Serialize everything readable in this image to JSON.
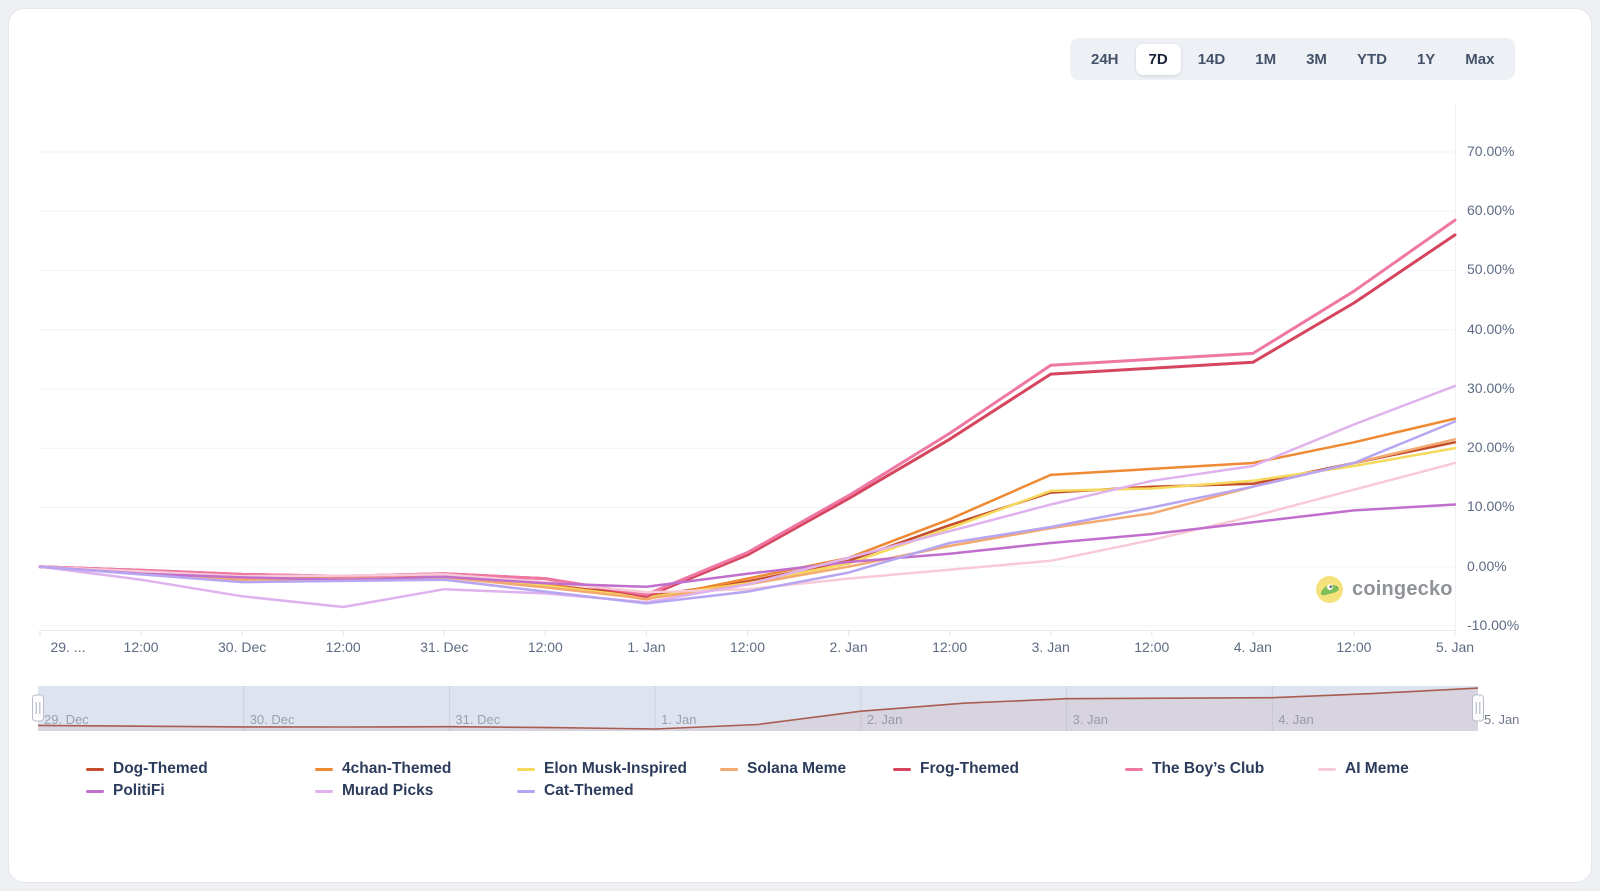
{
  "range_selector": {
    "options": [
      "24H",
      "7D",
      "14D",
      "1M",
      "3M",
      "YTD",
      "1Y",
      "Max"
    ],
    "active": "7D"
  },
  "watermark": {
    "brand": "coingecko"
  },
  "chart_data": {
    "type": "line",
    "categories": [
      "29. ...",
      "12:00",
      "30. Dec",
      "12:00",
      "31. Dec",
      "12:00",
      "1. Jan",
      "12:00",
      "2. Jan",
      "12:00",
      "3. Jan",
      "12:00",
      "4. Jan",
      "12:00",
      "5. Jan"
    ],
    "yticks": [
      {
        "label": "70.00%",
        "value": 70
      },
      {
        "label": "60.00%",
        "value": 60
      },
      {
        "label": "50.00%",
        "value": 50
      },
      {
        "label": "40.00%",
        "value": 40
      },
      {
        "label": "30.00%",
        "value": 30
      },
      {
        "label": "20.00%",
        "value": 20
      },
      {
        "label": "10.00%",
        "value": 10
      },
      {
        "label": "0.00%",
        "value": 0
      },
      {
        "label": "-10.00%",
        "value": -10
      }
    ],
    "ylim": [
      -10,
      70
    ],
    "grid": true,
    "legend_position": "bottom",
    "series": [
      {
        "name": "Dog-Themed",
        "color": "#C44D2C",
        "width": 2.5,
        "values": [
          0,
          -1,
          -2,
          -2,
          -1.5,
          -3,
          -5,
          -2.5,
          1,
          7,
          12.5,
          13.5,
          14,
          17.5,
          21
        ]
      },
      {
        "name": "4chan-Themed",
        "color": "#EE8A33",
        "width": 2.5,
        "values": [
          0,
          -1,
          -2,
          -1.8,
          -1.5,
          -3,
          -5.5,
          -2,
          1.5,
          8,
          15.5,
          16.5,
          17.5,
          21,
          25
        ]
      },
      {
        "name": "Elon Musk-Inspired",
        "color": "#F6D95C",
        "width": 2.5,
        "values": [
          0,
          -1.2,
          -2.2,
          -2,
          -1.8,
          -3.2,
          -5.2,
          -2.8,
          0.5,
          6.5,
          12.8,
          13.2,
          14.5,
          17,
          20
        ]
      },
      {
        "name": "Solana Meme",
        "color": "#F4A970",
        "width": 2.5,
        "values": [
          0,
          -1,
          -2.2,
          -2,
          -1.8,
          -3.5,
          -5.4,
          -3,
          0,
          3.5,
          6.5,
          9,
          13.5,
          17.5,
          21.5
        ]
      },
      {
        "name": "Frog-Themed",
        "color": "#D5455E",
        "width": 3,
        "values": [
          0,
          -0.6,
          -1.3,
          -1.6,
          -1.2,
          -2,
          -5,
          2,
          11.5,
          21.5,
          32.5,
          33.5,
          34.5,
          44.5,
          56
        ]
      },
      {
        "name": "The Boy’s Club",
        "color": "#EE77A3",
        "width": 3,
        "values": [
          0,
          -0.6,
          -1.3,
          -1.6,
          -1.2,
          -2,
          -4.7,
          2.4,
          12,
          22.5,
          34,
          35,
          36,
          46.5,
          58.5
        ]
      },
      {
        "name": "AI Meme",
        "color": "#F8CAD7",
        "width": 2.5,
        "values": [
          0,
          -0.8,
          -1.6,
          -1.5,
          -1.3,
          -2.6,
          -4.3,
          -3.8,
          -2,
          -0.5,
          1,
          4.5,
          8.5,
          13,
          17.5
        ]
      },
      {
        "name": "PolitiFi",
        "color": "#C06FCC",
        "width": 2.5,
        "values": [
          0,
          -1.2,
          -1.8,
          -2.2,
          -1.7,
          -2.8,
          -3.4,
          -1.2,
          0.8,
          2.2,
          4,
          5.5,
          7.5,
          9.5,
          10.5
        ]
      },
      {
        "name": "Murad Picks",
        "color": "#DFB2EE",
        "width": 2.5,
        "values": [
          0,
          -2.2,
          -5,
          -6.8,
          -3.8,
          -4.5,
          -6,
          -3,
          1.5,
          6,
          10.5,
          14.5,
          17,
          24,
          30.5
        ]
      },
      {
        "name": "Cat-Themed",
        "color": "#B7A5F1",
        "width": 2.5,
        "values": [
          0,
          -1.3,
          -2.6,
          -2.4,
          -2.2,
          -4.2,
          -6.2,
          -4.2,
          -1,
          4,
          6.7,
          10,
          13.5,
          17.5,
          24.5
        ]
      }
    ],
    "navigator": {
      "labels": [
        "29. Dec",
        "30. Dec",
        "31. Dec",
        "1. Jan",
        "2. Jan",
        "3. Jan",
        "4. Jan",
        "5. Jan"
      ],
      "color": "#A85D52",
      "values": [
        0,
        -0.4,
        -0.8,
        -0.9,
        -0.7,
        -1.2,
        -2,
        0.5,
        8,
        12.5,
        15,
        15.3,
        15.6,
        18,
        21
      ]
    }
  }
}
